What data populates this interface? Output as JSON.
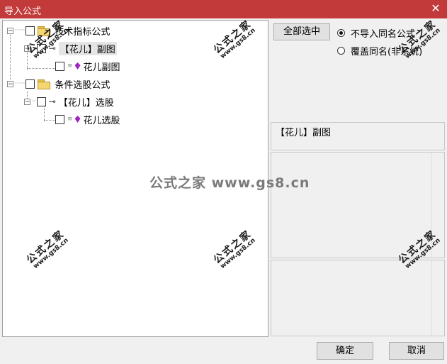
{
  "window": {
    "title": "导入公式",
    "close_glyph": "✕"
  },
  "tree": {
    "nodes": [
      {
        "expander": "−",
        "label": "技术指标公式",
        "icon": "folder-icon"
      },
      {
        "expander": "−",
        "label": "【花儿】副图",
        "icon": "key-icon"
      },
      {
        "label": "花儿副图",
        "icon": "gem-icon"
      },
      {
        "expander": "−",
        "label": "条件选股公式",
        "icon": "folder-icon"
      },
      {
        "expander": "−",
        "label": "【花儿】选股",
        "icon": "key-icon"
      },
      {
        "label": "花儿选股",
        "icon": "gem-icon"
      }
    ]
  },
  "right": {
    "select_all_label": "全部选中",
    "radio_options": [
      {
        "label": "不导入同名公式",
        "selected": true
      },
      {
        "label": "覆盖同名(非系统)",
        "selected": false
      }
    ],
    "name_panel_text": "【花儿】副图"
  },
  "buttons": {
    "ok_label": "确定",
    "cancel_label": "取消"
  },
  "watermark": {
    "brand": "公式之家",
    "url": "www.gs8.cn",
    "center_text": "公式之家 www.gs8.cn"
  },
  "colors": {
    "titlebar": "#c33a3a",
    "gem": "#a020c0",
    "folder": "#f5d671"
  }
}
